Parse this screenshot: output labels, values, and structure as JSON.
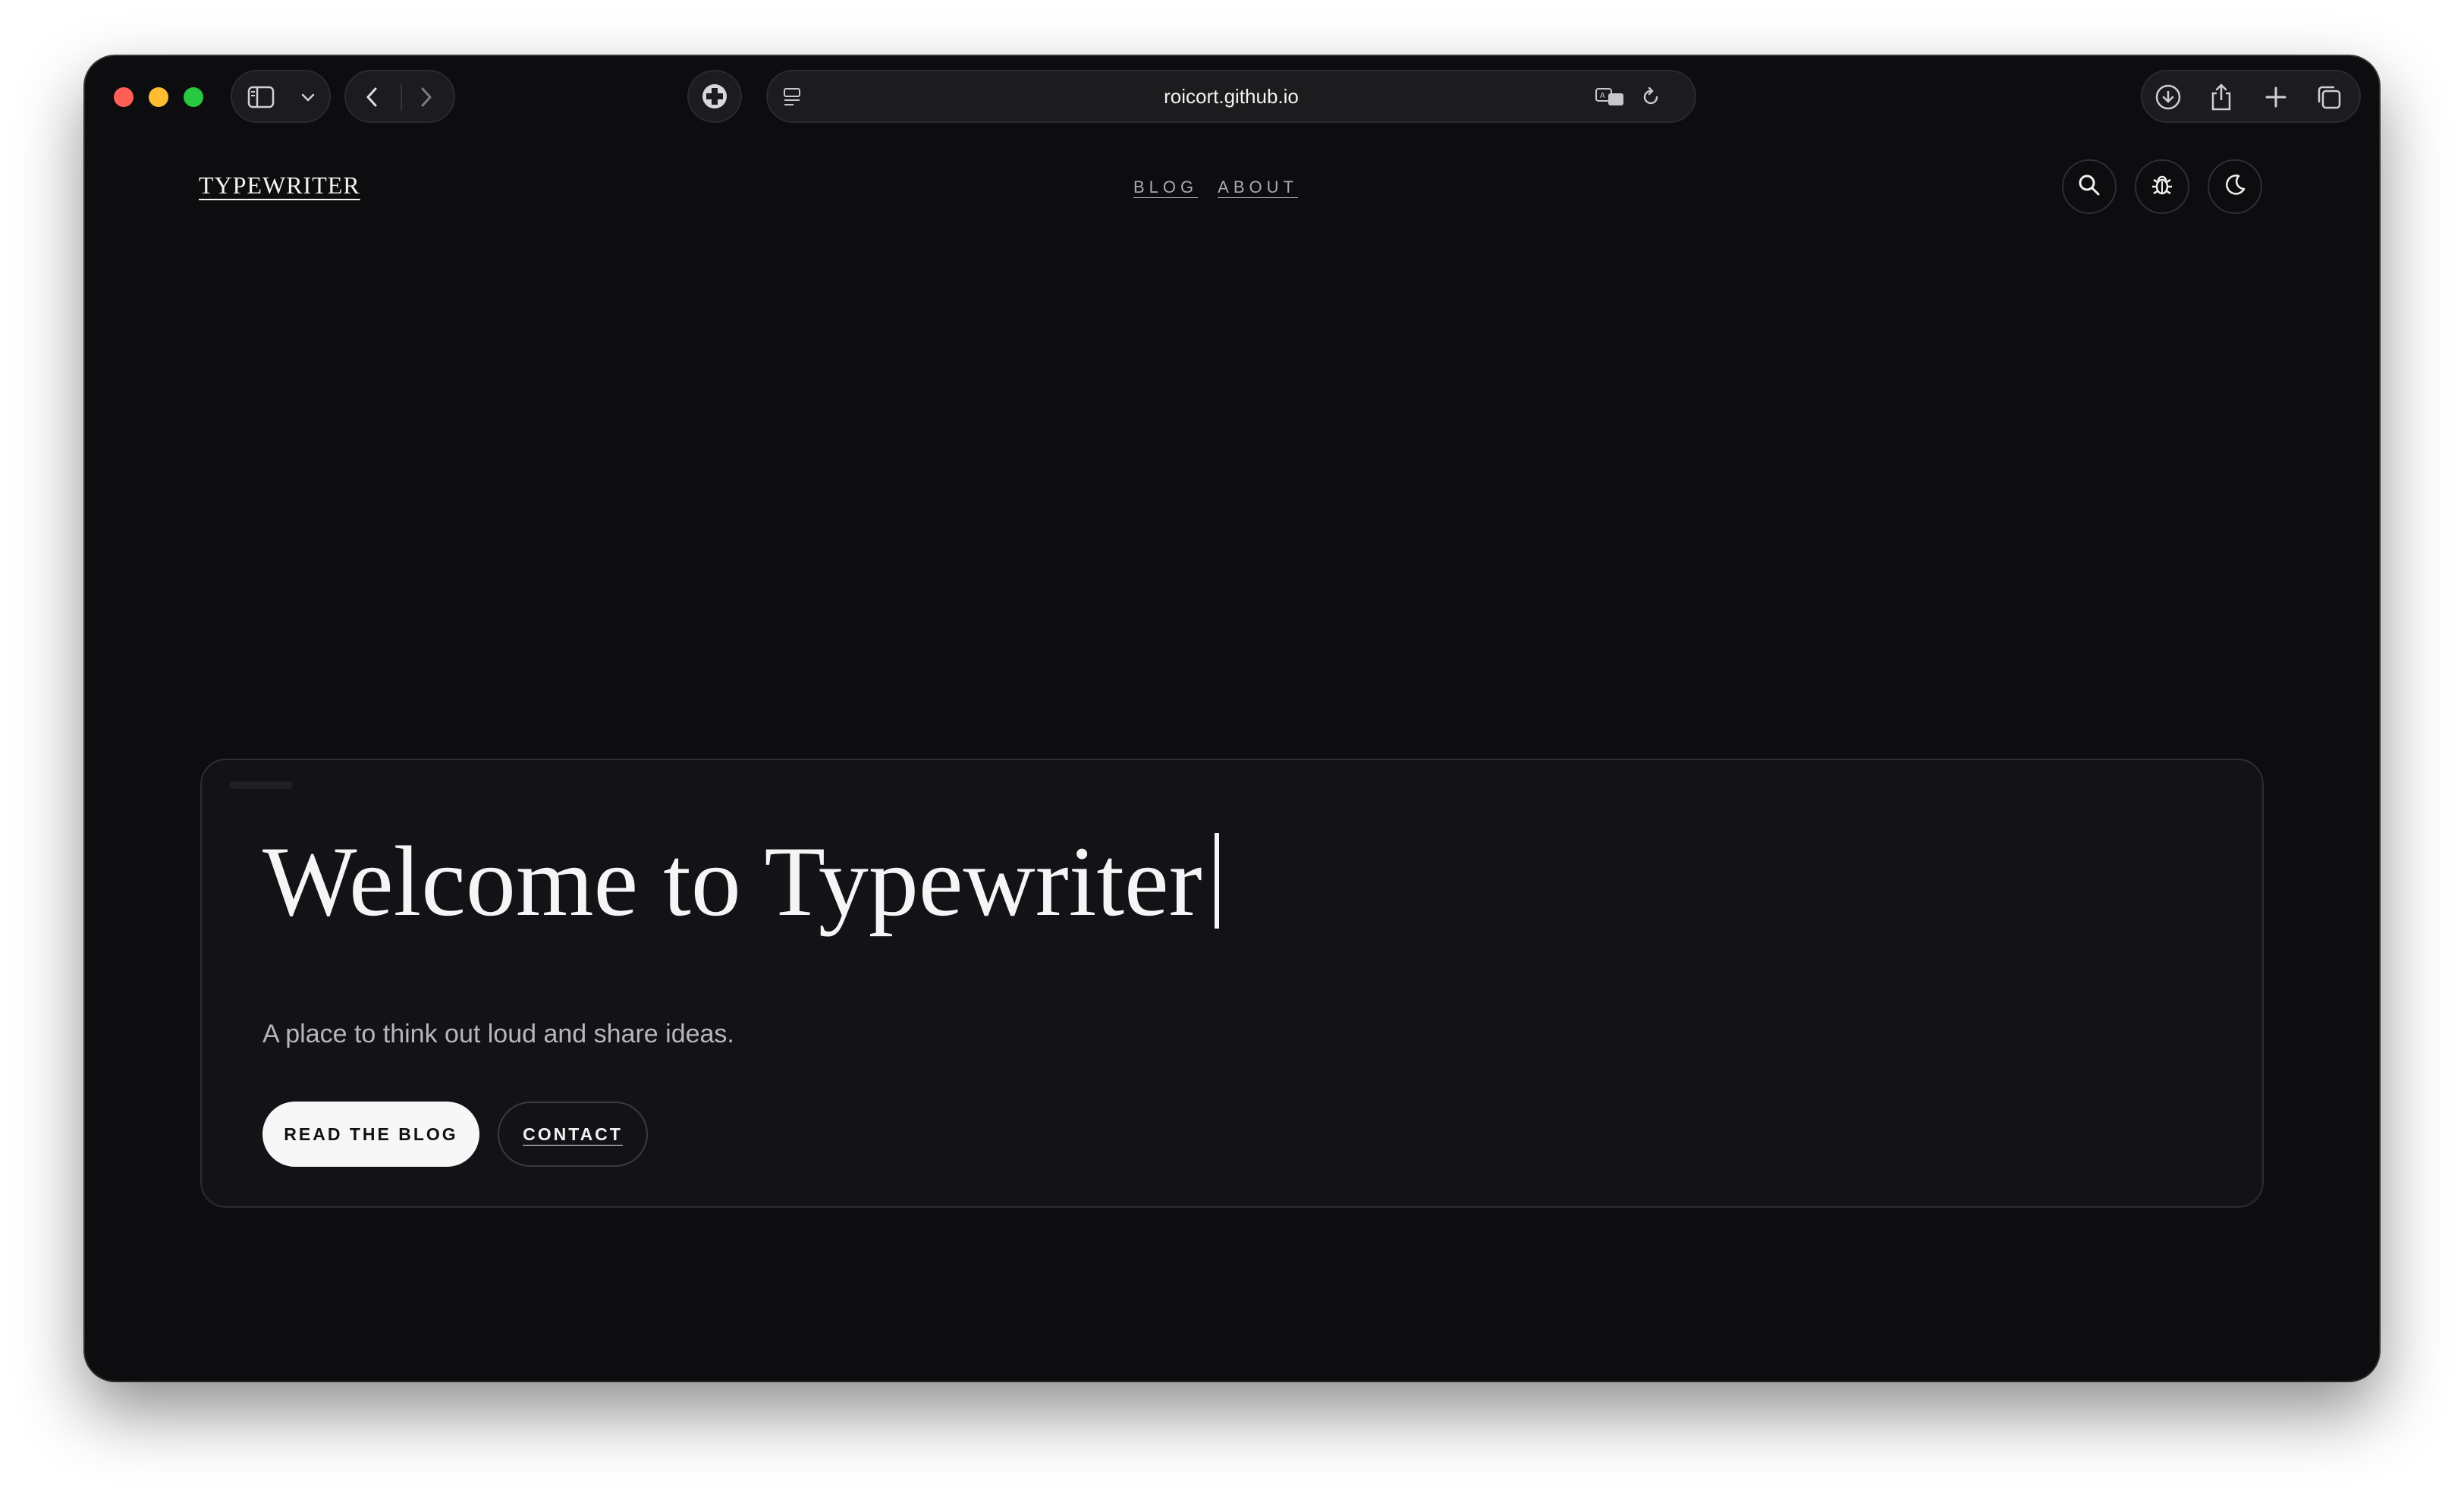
{
  "browser": {
    "url": "roicort.github.io",
    "icons": {
      "sidebar": "sidebar-icon",
      "chevron": "chevron-down-icon",
      "back": "back-arrow-icon",
      "forward": "forward-arrow-icon",
      "extension": "extension-icon",
      "reader": "reader-mode-icon",
      "translate": "translate-icon",
      "reload": "reload-icon",
      "download": "download-icon",
      "share": "share-icon",
      "new_tab": "plus-icon",
      "tabs": "tab-overview-icon"
    }
  },
  "site": {
    "logo": "TYPEWRITER",
    "nav": [
      {
        "label": "BLOG"
      },
      {
        "label": "ABOUT"
      }
    ],
    "header_icons": [
      "search-icon",
      "bug-icon",
      "moon-icon"
    ]
  },
  "hero": {
    "title": "Welcome to Typewriter",
    "subtitle": "A place to think out loud and share ideas.",
    "primary_button": "READ THE BLOG",
    "secondary_button": "CONTACT"
  },
  "colors": {
    "background": "#0d0d0f",
    "card": "#131317",
    "text": "#f5f5f5",
    "muted": "#b6b6bc"
  }
}
